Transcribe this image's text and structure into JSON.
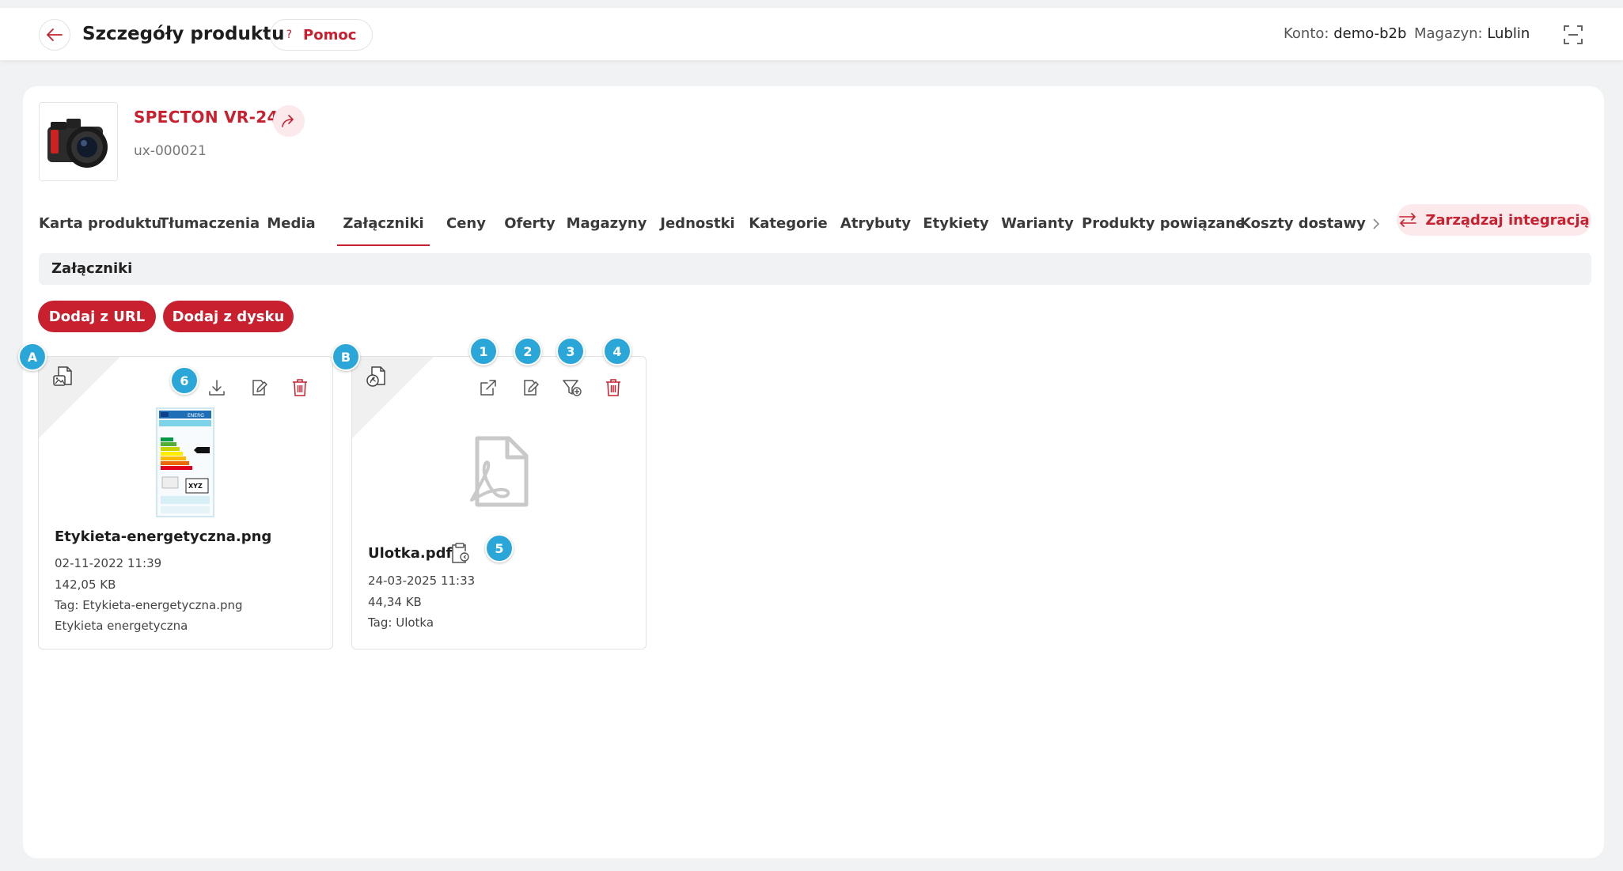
{
  "header": {
    "title": "Szczegóły produktu",
    "help_label": "Pomoc",
    "help_glyph": "?",
    "account_label": "Konto:",
    "account_value": "demo-b2b",
    "warehouse_label": "Magazyn:",
    "warehouse_value": "Lublin"
  },
  "product": {
    "name": "SPECTON VR-24",
    "code": "ux-000021"
  },
  "tabs": [
    {
      "label": "Karta produktu"
    },
    {
      "label": "Tłumaczenia"
    },
    {
      "label": "Media"
    },
    {
      "label": "Załączniki",
      "active": true
    },
    {
      "label": "Ceny"
    },
    {
      "label": "Oferty"
    },
    {
      "label": "Magazyny"
    },
    {
      "label": "Jednostki"
    },
    {
      "label": "Kategorie"
    },
    {
      "label": "Atrybuty"
    },
    {
      "label": "Etykiety"
    },
    {
      "label": "Warianty"
    },
    {
      "label": "Produkty powiązane"
    },
    {
      "label": "Koszty dostawy"
    }
  ],
  "manage_integration_label": "Zarządzaj integracją",
  "section": {
    "title": "Załączniki",
    "add_url_label": "Dodaj z URL",
    "add_disk_label": "Dodaj z dysku"
  },
  "attachments": [
    {
      "filename": "Etykieta-energetyczna.png",
      "date": "02-11-2022 11:39",
      "size": "142,05 KB",
      "tag": "Tag: Etykieta-energetyczna.png",
      "description": "Etykieta energetyczna"
    },
    {
      "filename": "Ulotka.pdf",
      "date": "24-03-2025 11:33",
      "size": "44,34 KB",
      "tag": "Tag: Ulotka"
    }
  ],
  "energy_label": {
    "header": "ENERG",
    "code": "XYZ"
  },
  "badges": {
    "a": "A",
    "b": "B",
    "n1": "1",
    "n2": "2",
    "n3": "3",
    "n4": "4",
    "n5": "5",
    "n6": "6"
  },
  "colors": {
    "brand_red": "#c8202f",
    "brand_red_soft": "#fbe9eb",
    "badge_blue": "#2aa7d8"
  }
}
